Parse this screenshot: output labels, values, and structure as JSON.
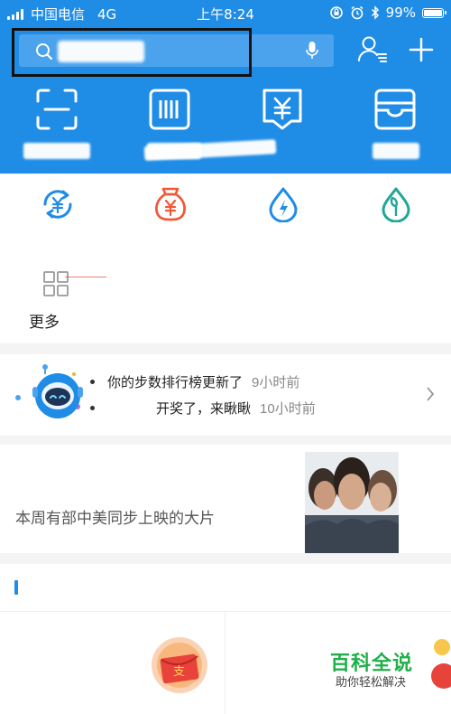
{
  "status_bar": {
    "carrier": "中国电信",
    "network": "4G",
    "time": "上午8:24",
    "battery": "99%",
    "battery_level": 0.99
  },
  "search": {
    "placeholder": ""
  },
  "quick_actions": [
    {
      "id": "scan",
      "label": "",
      "icon": "scan-icon"
    },
    {
      "id": "pay",
      "label": "",
      "icon": "barcode-pay-icon"
    },
    {
      "id": "collect",
      "label": "",
      "icon": "yuan-receipt-icon"
    },
    {
      "id": "card",
      "label": "",
      "icon": "card-wallet-icon"
    }
  ],
  "apps": [
    {
      "icon": "yuan-transfer-icon",
      "color": "#1f8ce6"
    },
    {
      "icon": "money-bag-icon",
      "color": "#f05a3a"
    },
    {
      "icon": "lightning-drop-icon",
      "color": "#1f8ce6"
    },
    {
      "icon": "leaf-drop-icon",
      "color": "#20a69a"
    }
  ],
  "more": {
    "label": "更多"
  },
  "notices": [
    {
      "text": "你的步数排行榜更新了",
      "time": "9小时前"
    },
    {
      "text": "开奖了，来瞅瞅",
      "time": "10小时前"
    }
  ],
  "promo": {
    "text": "本周有部中美同步上映的大片"
  },
  "watermark": {
    "title": "百科全说",
    "subtitle": "助你轻松解决"
  },
  "colors": {
    "brand_blue": "#1f8ce6",
    "header_search": "#4aa3ec",
    "red": "#f05a3a",
    "teal": "#20a69a"
  }
}
